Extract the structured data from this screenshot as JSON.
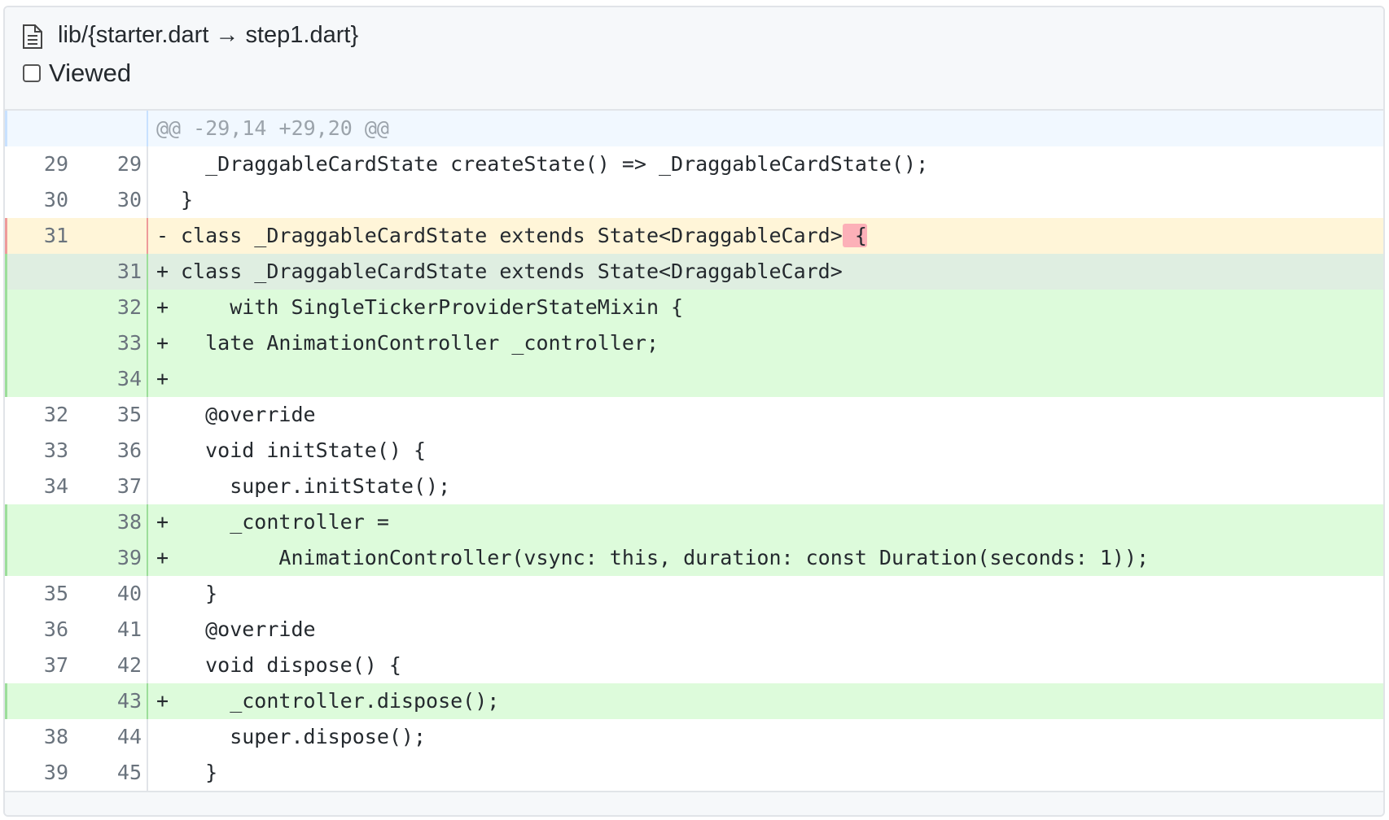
{
  "file": {
    "path": "lib/{starter.dart → step1.dart}",
    "viewed_label": "Viewed",
    "icon": "file-icon"
  },
  "hunk": "@@ -29,14 +29,20 @@",
  "lines": [
    {
      "type": "ctx",
      "old": "29",
      "new": "29",
      "marker": " ",
      "text": "  _DraggableCardState createState() => _DraggableCardState();"
    },
    {
      "type": "ctx",
      "old": "30",
      "new": "30",
      "marker": " ",
      "text": "}"
    },
    {
      "type": "del",
      "old": "31",
      "new": "",
      "marker": "-",
      "text": "class _DraggableCardState extends State<DraggableCard>",
      "highlight": " {"
    },
    {
      "type": "add",
      "old": "",
      "new": "31",
      "marker": "+",
      "text": "class _DraggableCardState extends State<DraggableCard>",
      "first": true
    },
    {
      "type": "add",
      "old": "",
      "new": "32",
      "marker": "+",
      "text": "    with SingleTickerProviderStateMixin {"
    },
    {
      "type": "add",
      "old": "",
      "new": "33",
      "marker": "+",
      "text": "  late AnimationController _controller;"
    },
    {
      "type": "add",
      "old": "",
      "new": "34",
      "marker": "+",
      "text": ""
    },
    {
      "type": "ctx",
      "old": "32",
      "new": "35",
      "marker": " ",
      "text": "  @override"
    },
    {
      "type": "ctx",
      "old": "33",
      "new": "36",
      "marker": " ",
      "text": "  void initState() {"
    },
    {
      "type": "ctx",
      "old": "34",
      "new": "37",
      "marker": " ",
      "text": "    super.initState();"
    },
    {
      "type": "add",
      "old": "",
      "new": "38",
      "marker": "+",
      "text": "    _controller ="
    },
    {
      "type": "add",
      "old": "",
      "new": "39",
      "marker": "+",
      "text": "        AnimationController(vsync: this, duration: const Duration(seconds: 1));"
    },
    {
      "type": "ctx",
      "old": "35",
      "new": "40",
      "marker": " ",
      "text": "  }"
    },
    {
      "type": "ctx",
      "old": "36",
      "new": "41",
      "marker": " ",
      "text": "  @override"
    },
    {
      "type": "ctx",
      "old": "37",
      "new": "42",
      "marker": " ",
      "text": "  void dispose() {"
    },
    {
      "type": "add",
      "old": "",
      "new": "43",
      "marker": "+",
      "text": "    _controller.dispose();"
    },
    {
      "type": "ctx",
      "old": "38",
      "new": "44",
      "marker": " ",
      "text": "    super.dispose();"
    },
    {
      "type": "ctx",
      "old": "39",
      "new": "45",
      "marker": " ",
      "text": "  }"
    }
  ]
}
